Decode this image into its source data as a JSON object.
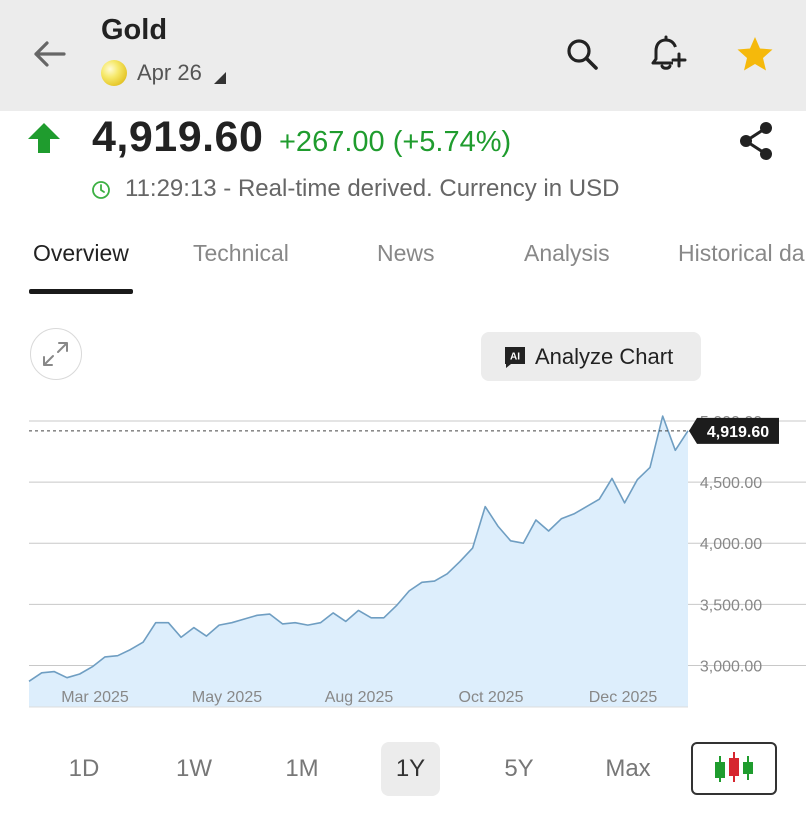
{
  "header": {
    "title": "Gold",
    "contract": "Apr 26",
    "icons": {
      "back": "arrow-left-icon",
      "search": "search-icon",
      "alert": "bell-plus-icon",
      "watchlist": "star-icon"
    },
    "star_color": "#f5b90b"
  },
  "quote": {
    "price": "4,919.60",
    "change": "+267.00 (+5.74%)",
    "status": "11:29:13 - Real-time derived. Currency in USD",
    "change_color": "#1f9c2e"
  },
  "tabs": [
    {
      "label": "Overview"
    },
    {
      "label": "Technical"
    },
    {
      "label": "News"
    },
    {
      "label": "Analysis"
    },
    {
      "label": "Historical da"
    }
  ],
  "chart_controls": {
    "analyze_label": "Analyze Chart",
    "ai_badge": "AI"
  },
  "chart_data": {
    "type": "area",
    "x_tick_labels": [
      "Mar 2025",
      "May 2025",
      "Aug 2025",
      "Oct 2025",
      "Dec 2025"
    ],
    "y_tick_labels": [
      "5,000.00",
      "4,500.00",
      "4,000.00",
      "3,500.00",
      "3,000.00"
    ],
    "y_ticks": [
      5000,
      4500,
      4000,
      3500,
      3000
    ],
    "ylim": [
      2660,
      5000
    ],
    "last_value": 4919.6,
    "last_value_label": "4,919.60",
    "values": [
      2870,
      2940,
      2950,
      2900,
      2930,
      2990,
      3070,
      3080,
      3130,
      3190,
      3350,
      3350,
      3230,
      3310,
      3240,
      3330,
      3350,
      3380,
      3410,
      3420,
      3340,
      3350,
      3330,
      3350,
      3430,
      3360,
      3450,
      3390,
      3390,
      3490,
      3610,
      3680,
      3690,
      3750,
      3850,
      3960,
      4300,
      4140,
      4020,
      4000,
      4190,
      4100,
      4200,
      4240,
      4300,
      4360,
      4530,
      4330,
      4520,
      4620,
      5040,
      4760,
      4920
    ],
    "grid": true,
    "line_color": "#6f9ec2",
    "fill_color": "#ddeefc"
  },
  "ranges": [
    {
      "label": "1D"
    },
    {
      "label": "1W"
    },
    {
      "label": "1M"
    },
    {
      "label": "1Y",
      "selected": true
    },
    {
      "label": "5Y"
    },
    {
      "label": "Max"
    }
  ],
  "chart_type_icon": "candlestick-icon"
}
